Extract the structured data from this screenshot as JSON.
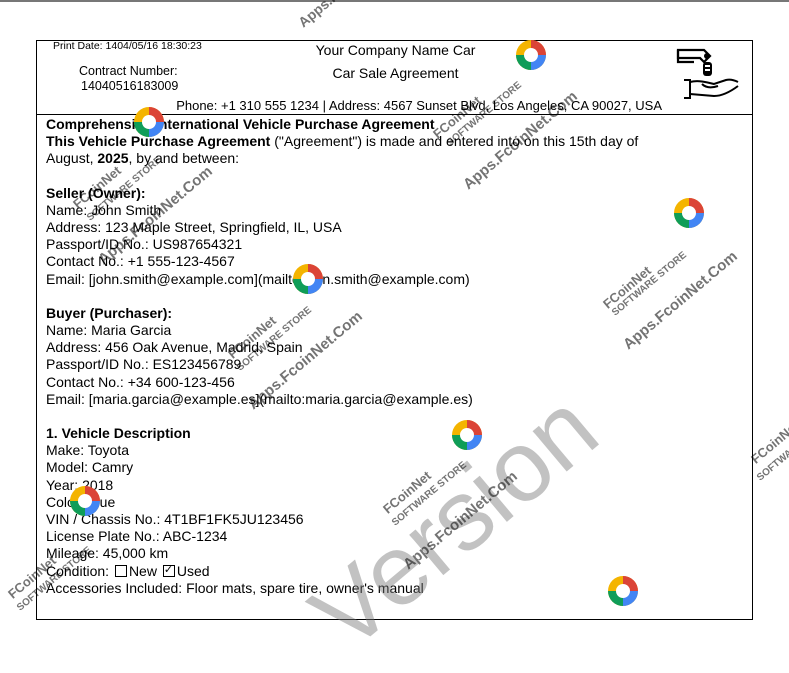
{
  "header": {
    "print_date": "Print Date: 1404/05/16 18:30:23",
    "contract_label": "Contract Number:",
    "contract_number": "14040516183009",
    "company_name": "Your Company Name Car",
    "agreement_title": "Car Sale Agreement",
    "contact_line": "Phone: +1 310 555 1234 | Address: 4567 Sunset Blvd, Los Angeles, CA 90027, USA",
    "logo_icon": "car-key-hand-icon"
  },
  "intro": {
    "title": "Comprehensive International Vehicle Purchase Agreement",
    "lead_bold": "This Vehicle Purchase Agreement",
    "lead_rest": " (\"Agreement\") is made and entered into on this 15th day of",
    "date_prefix": "August, ",
    "date_year": "2025",
    "date_suffix": ", by and between:"
  },
  "seller": {
    "heading": "Seller (Owner):",
    "name": "Name: John Smith",
    "address": "Address: 123 Maple Street, Springfield, IL, USA",
    "passport": "Passport/ID No.: US987654321",
    "contact": "Contact No.: +1 555-123-4567",
    "email": "Email: [john.smith@example.com](mailto:john.smith@example.com)"
  },
  "buyer": {
    "heading": "Buyer (Purchaser):",
    "name": "Name: Maria Garcia",
    "address": "Address: 456 Oak Avenue, Madrid, Spain",
    "passport": "Passport/ID No.: ES123456789",
    "contact": "Contact No.: +34 600-123-456",
    "email": "Email: [maria.garcia@example.es](mailto:maria.garcia@example.es)"
  },
  "vehicle": {
    "heading": "1. Vehicle Description",
    "make": "Make: Toyota",
    "model": "Model: Camry",
    "year": "Year: 2018",
    "color": "Color: Blue",
    "vin": "VIN / Chassis No.: 4T1BF1FK5JU123456",
    "plate": "License Plate No.: ABC-1234",
    "mileage": "Mileage: 45,000 km",
    "condition_label": "Condition:",
    "condition_new": "New",
    "condition_used": "Used",
    "accessories": "Accessories Included: Floor mats, spare tire, owner's manual"
  },
  "watermark": {
    "line1": "FCoinNet",
    "line2": "SOFTWARE STORE",
    "line3": "Apps.FcoinNet.Com",
    "big": "Version"
  }
}
